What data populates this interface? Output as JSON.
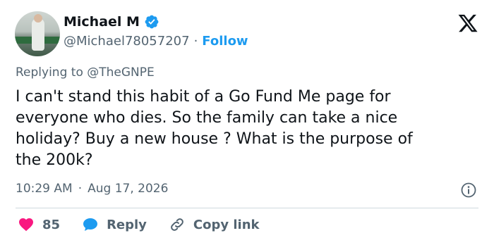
{
  "user": {
    "name": "Michael M",
    "handle": "@Michael78057207",
    "separator": "·",
    "follow_label": "Follow"
  },
  "reply": {
    "prefix": "Replying to ",
    "mention": "@TheGNPE"
  },
  "tweet": {
    "text": "I can't stand this habit of a Go Fund Me page for\neveryone who dies. So the family can take a nice\nholiday? Buy a new house ? What is the purpose of\nthe 200k?"
  },
  "meta": {
    "time": "10:29 AM",
    "separator": "·",
    "date": "Aug 17, 2026"
  },
  "actions": {
    "likes_count": "85",
    "reply_label": "Reply",
    "copy_link_label": "Copy link"
  },
  "colors": {
    "like": "#f91880",
    "reply": "#1d9bf0",
    "link": "#1d9bf0",
    "secondary": "#536471"
  },
  "icons": {
    "verified": "verified-badge-icon",
    "logo": "x-logo-icon",
    "info": "info-icon",
    "like": "heart-icon",
    "reply": "speech-bubble-icon",
    "copy": "link-icon"
  }
}
